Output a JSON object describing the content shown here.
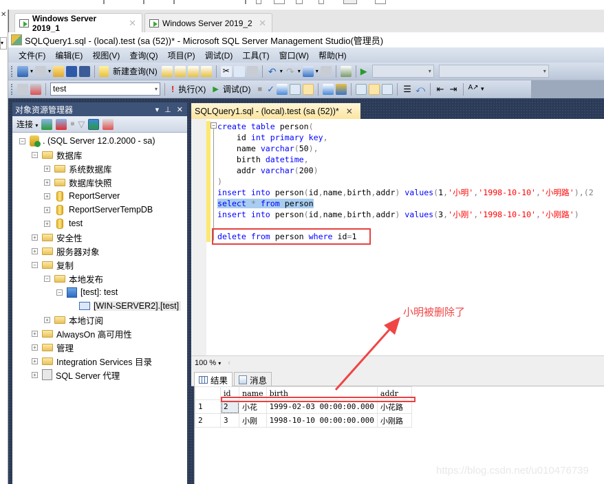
{
  "vm_tabs": [
    {
      "label": "Windows Server 2019_1",
      "active": true
    },
    {
      "label": "Windows Server 2019_2",
      "active": false
    }
  ],
  "window_title": "SQLQuery1.sql - (local).test (sa (52))* - Microsoft SQL Server Management Studio(管理员)",
  "menu": [
    "文件(F)",
    "编辑(E)",
    "视图(V)",
    "查询(Q)",
    "项目(P)",
    "调试(D)",
    "工具(T)",
    "窗口(W)",
    "帮助(H)"
  ],
  "toolbar": {
    "new_query": "新建查询(N)",
    "database": "test",
    "execute": "执行(X)",
    "debug": "调试(D)"
  },
  "object_explorer": {
    "title": "对象资源管理器",
    "connect": "连接",
    "tree": [
      {
        "label": ". (SQL Server 12.0.2000 - sa)",
        "icon": "server-icon",
        "level": 0,
        "state": "expanded"
      },
      {
        "label": "数据库",
        "icon": "folder-icon",
        "level": 1,
        "state": "expanded"
      },
      {
        "label": "系统数据库",
        "icon": "folder-icon",
        "level": 2,
        "state": "collapsed"
      },
      {
        "label": "数据库快照",
        "icon": "folder-icon",
        "level": 2,
        "state": "collapsed"
      },
      {
        "label": "ReportServer",
        "icon": "database-icon",
        "level": 2,
        "state": "collapsed"
      },
      {
        "label": "ReportServerTempDB",
        "icon": "database-icon",
        "level": 2,
        "state": "collapsed"
      },
      {
        "label": "test",
        "icon": "database-icon",
        "level": 2,
        "state": "collapsed"
      },
      {
        "label": "安全性",
        "icon": "folder-icon",
        "level": 1,
        "state": "collapsed"
      },
      {
        "label": "服务器对象",
        "icon": "folder-icon",
        "level": 1,
        "state": "collapsed"
      },
      {
        "label": "复制",
        "icon": "folder-icon",
        "level": 1,
        "state": "expanded"
      },
      {
        "label": "本地发布",
        "icon": "folder-icon",
        "level": 2,
        "state": "expanded"
      },
      {
        "label": "[test]: test",
        "icon": "publication-icon",
        "level": 3,
        "state": "expanded"
      },
      {
        "label": "[WIN-SERVER2].[test]",
        "icon": "subscription-icon",
        "level": 4,
        "state": "leaf",
        "selected": true
      },
      {
        "label": "本地订阅",
        "icon": "folder-icon",
        "level": 2,
        "state": "collapsed"
      },
      {
        "label": "AlwaysOn 高可用性",
        "icon": "folder-icon",
        "level": 1,
        "state": "collapsed"
      },
      {
        "label": "管理",
        "icon": "folder-icon",
        "level": 1,
        "state": "collapsed"
      },
      {
        "label": "Integration Services 目录",
        "icon": "folder-icon",
        "level": 1,
        "state": "collapsed"
      },
      {
        "label": "SQL Server 代理",
        "icon": "agent-icon",
        "level": 1,
        "state": "collapsed"
      }
    ]
  },
  "editor": {
    "tab_label": "SQLQuery1.sql - (local).test (sa (52))*",
    "lines": [
      [
        {
          "t": "create table ",
          "c": "kw"
        },
        {
          "t": "person",
          "c": ""
        },
        {
          "t": "(",
          "c": "gr"
        }
      ],
      [
        {
          "t": "    id ",
          "c": ""
        },
        {
          "t": "int primary key",
          "c": "kw"
        },
        {
          "t": ",",
          "c": "gr"
        }
      ],
      [
        {
          "t": "    name ",
          "c": ""
        },
        {
          "t": "varchar",
          "c": "kw"
        },
        {
          "t": "(",
          "c": "gr"
        },
        {
          "t": "50",
          "c": ""
        },
        {
          "t": "),",
          "c": "gr"
        }
      ],
      [
        {
          "t": "    birth ",
          "c": ""
        },
        {
          "t": "datetime",
          "c": "kw"
        },
        {
          "t": ",",
          "c": "gr"
        }
      ],
      [
        {
          "t": "    addr ",
          "c": ""
        },
        {
          "t": "varchar",
          "c": "kw"
        },
        {
          "t": "(",
          "c": "gr"
        },
        {
          "t": "200",
          "c": ""
        },
        {
          "t": ")",
          "c": "gr"
        }
      ],
      [
        {
          "t": ")",
          "c": "gr"
        }
      ],
      [
        {
          "t": "insert into ",
          "c": "kw"
        },
        {
          "t": "person",
          "c": ""
        },
        {
          "t": "(",
          "c": "gr"
        },
        {
          "t": "id",
          "c": ""
        },
        {
          "t": ",",
          "c": "gr"
        },
        {
          "t": "name",
          "c": ""
        },
        {
          "t": ",",
          "c": "gr"
        },
        {
          "t": "birth",
          "c": ""
        },
        {
          "t": ",",
          "c": "gr"
        },
        {
          "t": "addr",
          "c": ""
        },
        {
          "t": ") ",
          "c": "gr"
        },
        {
          "t": "values",
          "c": "kw"
        },
        {
          "t": "(",
          "c": "gr"
        },
        {
          "t": "1",
          "c": ""
        },
        {
          "t": ",",
          "c": "gr"
        },
        {
          "t": "'小明'",
          "c": "str"
        },
        {
          "t": ",",
          "c": "gr"
        },
        {
          "t": "'1998-10-10'",
          "c": "str"
        },
        {
          "t": ",",
          "c": "gr"
        },
        {
          "t": "'小明路'",
          "c": "str"
        },
        {
          "t": "),(2",
          "c": "gr"
        }
      ],
      [
        {
          "t": "select ",
          "c": "kw sel"
        },
        {
          "t": "* ",
          "c": "gr sel"
        },
        {
          "t": "from ",
          "c": "kw sel"
        },
        {
          "t": "person",
          "c": "sel"
        }
      ],
      [
        {
          "t": "insert into ",
          "c": "kw"
        },
        {
          "t": "person",
          "c": ""
        },
        {
          "t": "(",
          "c": "gr"
        },
        {
          "t": "id",
          "c": ""
        },
        {
          "t": ",",
          "c": "gr"
        },
        {
          "t": "name",
          "c": ""
        },
        {
          "t": ",",
          "c": "gr"
        },
        {
          "t": "birth",
          "c": ""
        },
        {
          "t": ",",
          "c": "gr"
        },
        {
          "t": "addr",
          "c": ""
        },
        {
          "t": ") ",
          "c": "gr"
        },
        {
          "t": "values",
          "c": "kw"
        },
        {
          "t": "(",
          "c": "gr"
        },
        {
          "t": "3",
          "c": ""
        },
        {
          "t": ",",
          "c": "gr"
        },
        {
          "t": "'小刚'",
          "c": "str"
        },
        {
          "t": ",",
          "c": "gr"
        },
        {
          "t": "'1998-10-10'",
          "c": "str"
        },
        {
          "t": ",",
          "c": "gr"
        },
        {
          "t": "'小刚路'",
          "c": "str"
        },
        {
          "t": ")",
          "c": "gr"
        }
      ],
      [],
      [
        {
          "t": "delete from ",
          "c": "kw"
        },
        {
          "t": "person ",
          "c": ""
        },
        {
          "t": "where ",
          "c": "kw"
        },
        {
          "t": "id",
          "c": ""
        },
        {
          "t": "=",
          "c": "gr"
        },
        {
          "t": "1",
          "c": ""
        }
      ]
    ]
  },
  "zoom_level": "100 %",
  "results": {
    "tabs": [
      "结果",
      "消息"
    ],
    "columns": [
      "id",
      "name",
      "birth",
      "addr"
    ],
    "rows": [
      {
        "n": "1",
        "cells": [
          "2",
          "小花",
          "1999-02-03 00:00:00.000",
          "小花路"
        ]
      },
      {
        "n": "2",
        "cells": [
          "3",
          "小刚",
          "1998-10-10 00:00:00.000",
          "小刚路"
        ]
      }
    ]
  },
  "annotation": {
    "text": "小明被删除了",
    "color": "#f04545"
  },
  "watermark": "https://blog.csdn.net/u010476739"
}
